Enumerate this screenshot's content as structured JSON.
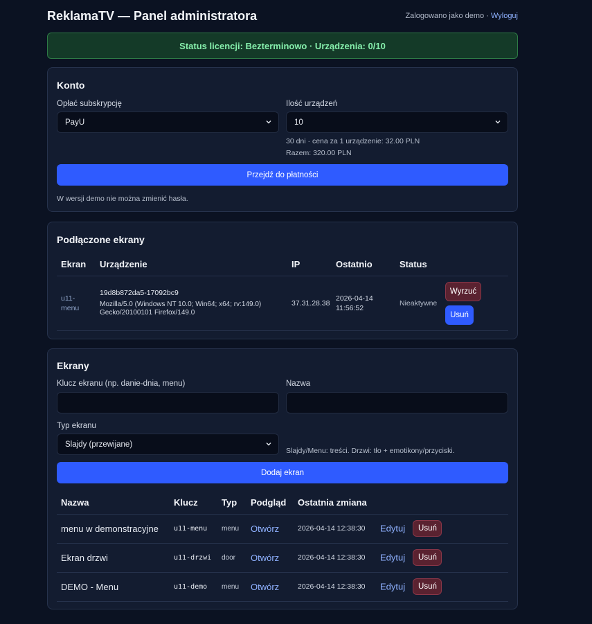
{
  "header": {
    "title": "ReklamaTV — Panel administratora",
    "logged_in_text": "Zalogowano jako demo ·",
    "logout_label": "Wyloguj"
  },
  "license": {
    "text": "Status licencji: Bezterminowo · Urządzenia: 0/10"
  },
  "account": {
    "title": "Konto",
    "subscription_label": "Opłać subskrypcję",
    "subscription_value": "PayU",
    "devices_label": "Ilość urządzeń",
    "devices_value": "10",
    "price_line": "30 dni · cena za 1 urządzenie: 32.00 PLN",
    "total_line": "Razem: 320.00 PLN",
    "pay_button": "Przejdź do płatności",
    "demo_note": "W wersji demo nie można zmienić hasła."
  },
  "connected": {
    "title": "Podłączone ekrany",
    "columns": [
      "Ekran",
      "Urządzenie",
      "IP",
      "Ostatnio",
      "Status"
    ],
    "rows": [
      {
        "screen_line1": "u11-",
        "screen_line2": "menu",
        "device_id": "19d8b872da5-17092bc9",
        "ua_line1": "Mozilla/5.0 (Windows NT 10.0; Win64; x64; rv:149.0)",
        "ua_line2": "Gecko/20100101 Firefox/149.0",
        "ip": "37.31.28.38",
        "last_date": "2026-04-14",
        "last_time": "11:56:52",
        "status": "Nieaktywne",
        "kick_label": "Wyrzuć",
        "delete_label": "Usuń"
      }
    ]
  },
  "screens": {
    "title": "Ekrany",
    "key_label": "Klucz ekranu (np. danie-dnia, menu)",
    "key_value": "",
    "name_label": "Nazwa",
    "name_value": "",
    "type_label": "Typ ekranu",
    "type_value": "Slajdy (przewijane)",
    "type_hint": "Slajdy/Menu: treści. Drzwi: tło + emotikony/przyciski.",
    "add_button": "Dodaj ekran",
    "columns": [
      "Nazwa",
      "Klucz",
      "Typ",
      "Podgląd",
      "Ostatnia zmiana"
    ],
    "rows": [
      {
        "name": "menu w demonstracyjne",
        "key": "u11-menu",
        "type": "menu",
        "preview": "Otwórz",
        "changed": "2026-04-14 12:38:30",
        "edit": "Edytuj",
        "delete": "Usuń"
      },
      {
        "name": "Ekran drzwi",
        "key": "u11-drzwi",
        "type": "door",
        "preview": "Otwórz",
        "changed": "2026-04-14 12:38:30",
        "edit": "Edytuj",
        "delete": "Usuń"
      },
      {
        "name": "DEMO - Menu",
        "key": "u11-demo",
        "type": "menu",
        "preview": "Otwórz",
        "changed": "2026-04-14 12:38:30",
        "edit": "Edytuj",
        "delete": "Usuń"
      }
    ]
  }
}
